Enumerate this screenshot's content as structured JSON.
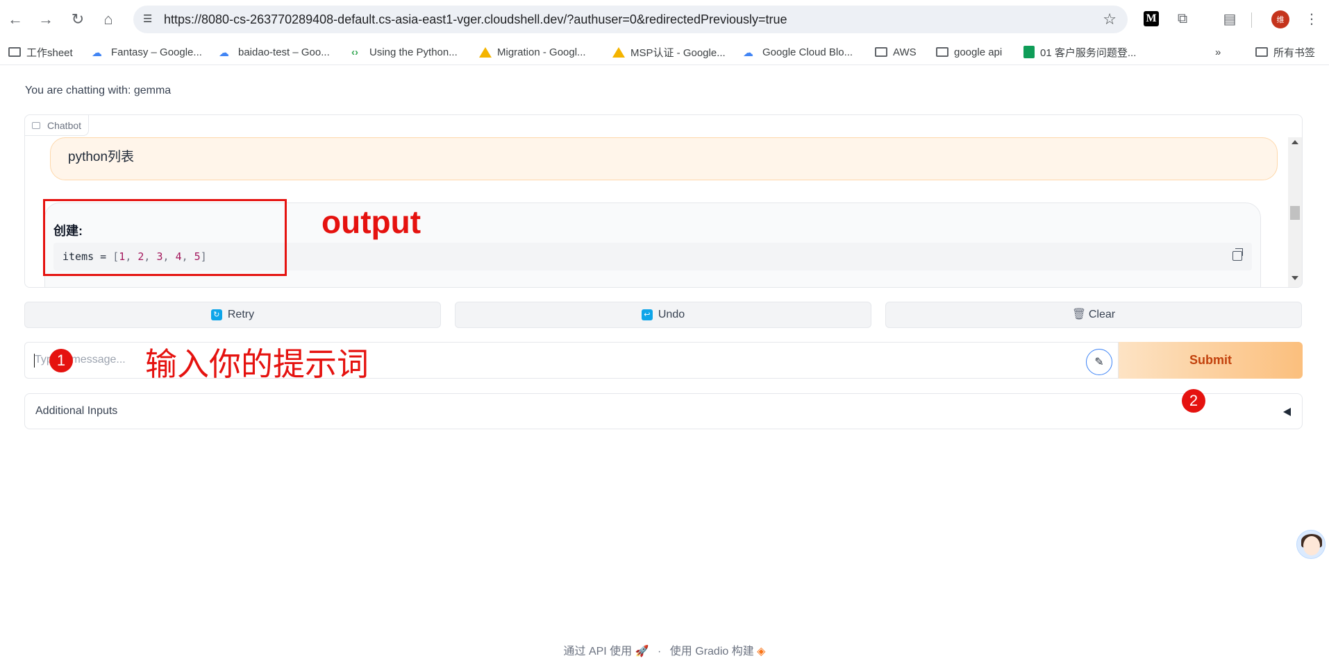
{
  "browser": {
    "url": "https://8080-cs-263770289408-default.cs-asia-east1-vger.cloudshell.dev/?authuser=0&redirectedPreviously=true",
    "profile_initial": "维",
    "bookmarks": [
      {
        "label": "工作sheet",
        "icon": "folder-icon"
      },
      {
        "label": "Fantasy – Google...",
        "icon": "google-cloud-icon"
      },
      {
        "label": "baidao-test – Goo...",
        "icon": "google-cloud-icon"
      },
      {
        "label": "Using the Python...",
        "icon": "site-icon"
      },
      {
        "label": "Migration - Googl...",
        "icon": "google-drive-icon"
      },
      {
        "label": "MSP认证 - Google...",
        "icon": "google-drive-icon"
      },
      {
        "label": "Google Cloud Blo...",
        "icon": "google-cloud-icon"
      },
      {
        "label": "AWS",
        "icon": "folder-icon"
      },
      {
        "label": "google api",
        "icon": "folder-icon"
      },
      {
        "label": "01 客户服务问题登...",
        "icon": "google-sheets-icon"
      }
    ],
    "all_bookmarks_label": "所有书签"
  },
  "app": {
    "chatting_with": "You are chatting with: gemma",
    "chatbot_label": "Chatbot",
    "user_message": "python列表",
    "bot_heading": "创建:",
    "code": {
      "prefix": "items = ",
      "open": "[",
      "numbers": [
        "1",
        "2",
        "3",
        "4",
        "5"
      ],
      "close": "]"
    },
    "buttons": {
      "retry": "Retry",
      "undo": "Undo",
      "clear": "Clear",
      "submit": "Submit"
    },
    "input_placeholder": "Type a message...",
    "additional_inputs": "Additional Inputs"
  },
  "annotations": {
    "output_label": "output",
    "prompt_label": "输入你的提示词",
    "marker_1": "1",
    "marker_2": "2"
  },
  "footer": {
    "api": "通过 API 使用",
    "separator": "·",
    "built_with": "使用 Gradio 构建"
  },
  "colors": {
    "annotation_red": "#e5120f",
    "submit_text": "#c2410c",
    "user_bubble": "#fff5ea"
  }
}
